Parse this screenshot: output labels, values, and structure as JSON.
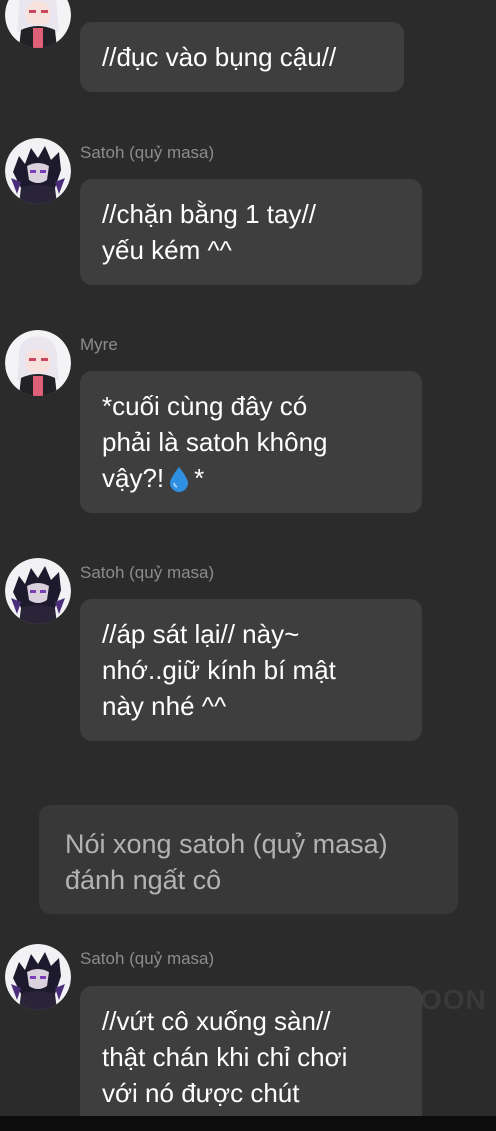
{
  "colors": {
    "background": "#2b2b2b",
    "bubble": "#3e3e3e",
    "narration_bubble": "#383838",
    "sender_text": "#8c8c8c",
    "message_text": "#ffffff",
    "narration_text": "#b3b3b3"
  },
  "messages": [
    {
      "avatar": "myre-avatar",
      "sender": "",
      "lines": [
        "//đục vào bụng cậu//"
      ]
    },
    {
      "avatar": "satoh-avatar",
      "sender": "Satoh (quỷ masa)",
      "lines": [
        "//chặn bằng 1 tay//",
        "yếu kém ^^"
      ]
    },
    {
      "avatar": "myre-avatar",
      "sender": "Myre",
      "lines": [
        "*cuối cùng đây có",
        "phải là satoh không",
        "vậy?!",
        "*"
      ],
      "emoji": "droplet-icon"
    },
    {
      "avatar": "satoh-avatar",
      "sender": "Satoh (quỷ masa)",
      "lines": [
        "//áp sát lại// này~",
        "nhớ..giữ kính bí mật",
        "này nhé ^^"
      ]
    },
    {
      "avatar": "satoh-avatar",
      "sender": "Satoh (quỷ masa)",
      "lines": [
        "//vứt cô xuống sàn//",
        "thật chán khi chỉ chơi",
        "với nó được chút"
      ]
    }
  ],
  "narration": {
    "lines": [
      "Nói xong satoh (quỷ masa)",
      "đánh ngất cô"
    ]
  },
  "watermark": "OON"
}
